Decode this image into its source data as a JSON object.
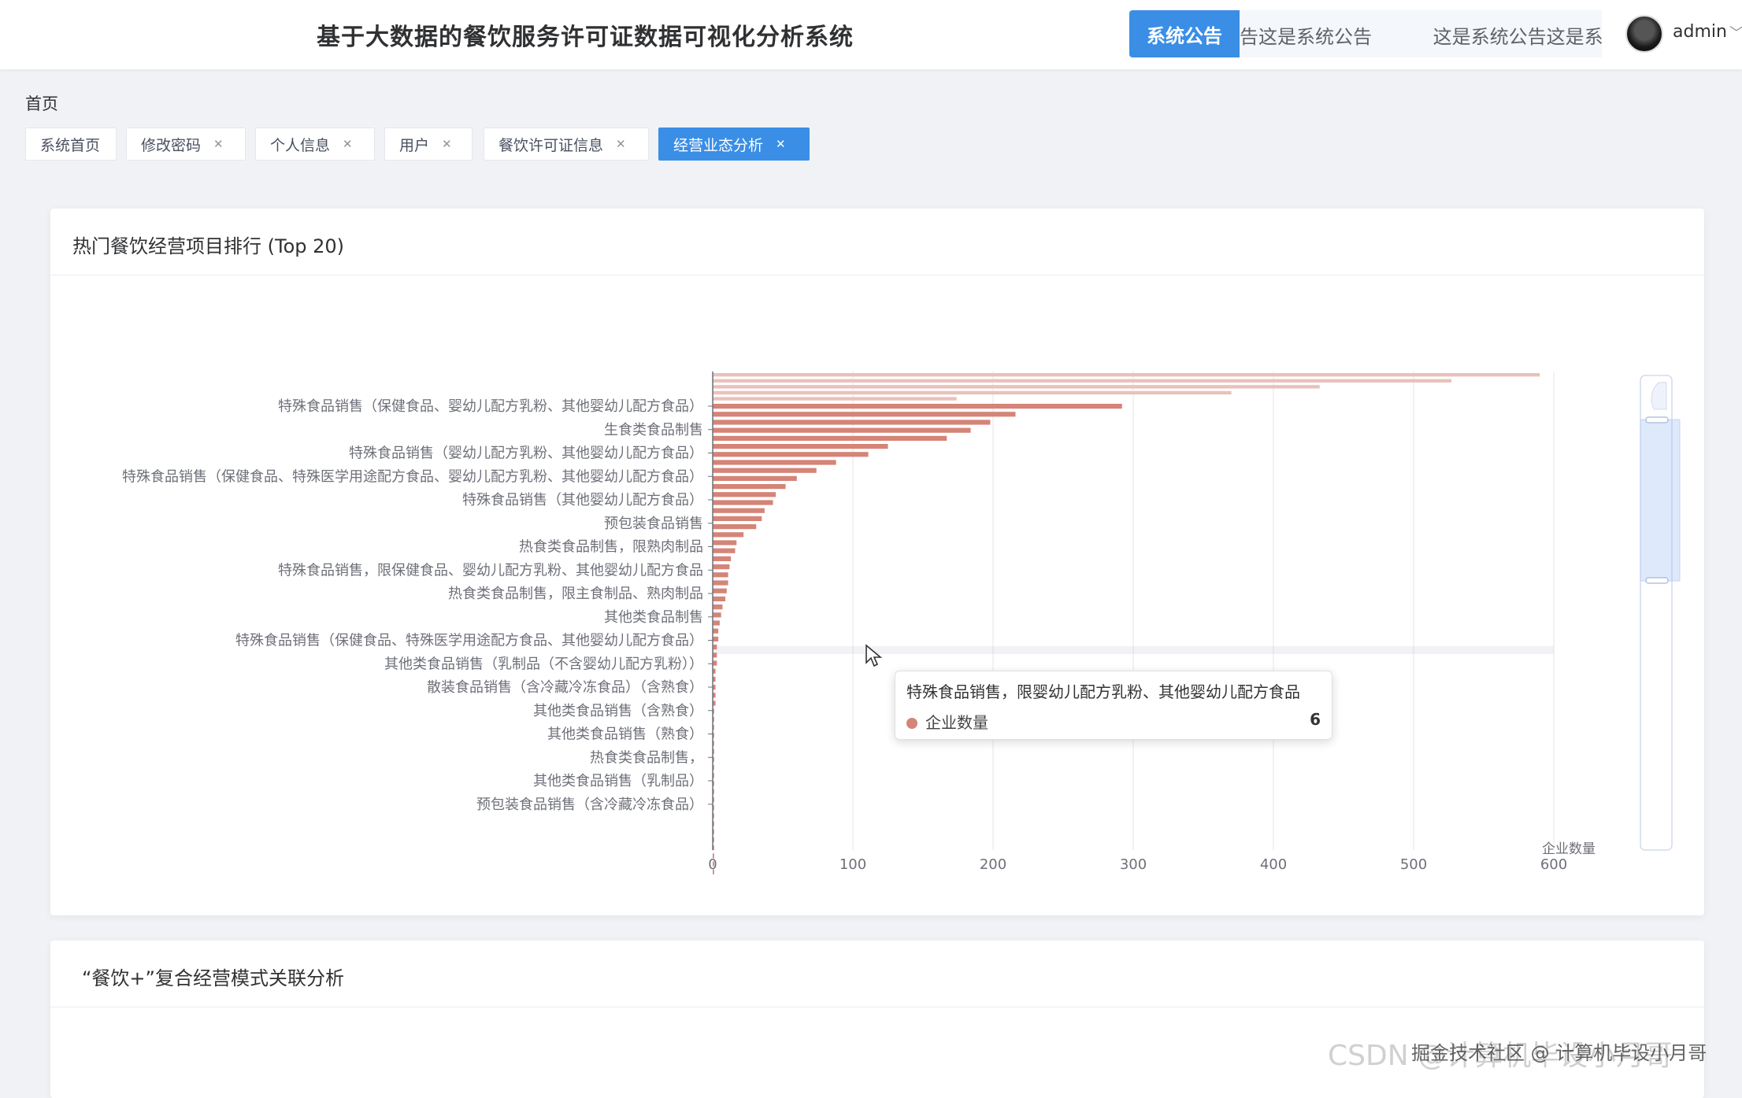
{
  "header": {
    "title": "基于大数据的餐饮服务许可证数据可视化分析系统",
    "notice_label": "系统公告",
    "notice_text": "公告这是系统公告 这是系统公告这是系",
    "username": "admin"
  },
  "breadcrumb": "首页",
  "tabs": [
    {
      "label": "系统首页",
      "closable": false,
      "active": false
    },
    {
      "label": "修改密码",
      "closable": true,
      "active": false
    },
    {
      "label": "个人信息",
      "closable": true,
      "active": false
    },
    {
      "label": "用户",
      "closable": true,
      "active": false
    },
    {
      "label": "餐饮许可证信息",
      "closable": true,
      "active": false
    },
    {
      "label": "经营业态分析",
      "closable": true,
      "active": true
    }
  ],
  "cards": {
    "top_title": "热门餐饮经营项目排行 (Top 20)",
    "bottom_title": "“餐饮+”复合经营模式关联分析"
  },
  "tooltip": {
    "title": "特殊食品销售，限婴幼儿配方乳粉、其他婴幼儿配方食品",
    "series": "企业数量",
    "value": "6"
  },
  "watermark": "CSDN @计算机毕设小月哥",
  "watermark_overlay": "掘金技术社区 @ 计算机毕设小月哥",
  "colors": {
    "primary": "#3a8ee6",
    "bar": "#d58478",
    "bar_faded": "#e9c2bb"
  },
  "chart_data": {
    "type": "bar",
    "orientation": "horizontal",
    "xlabel": "企业数量",
    "xlim": [
      0,
      600
    ],
    "x_ticks": [
      "0",
      "100",
      "200",
      "300",
      "400",
      "500",
      "600"
    ],
    "grid": true,
    "category_labels": [
      "特殊食品销售（保健食品、婴幼儿配方乳粉、其他婴幼儿配方食品）",
      "生食类食品制售",
      "特殊食品销售（婴幼儿配方乳粉、其他婴幼儿配方食品）",
      "特殊食品销售（保健食品、特殊医学用途配方食品、婴幼儿配方乳粉、其他婴幼儿配方食品）",
      "特殊食品销售（其他婴幼儿配方食品）",
      "预包装食品销售",
      "热食类食品制售，限熟肉制品",
      "特殊食品销售，限保健食品、婴幼儿配方乳粉、其他婴幼儿配方食品",
      "热食类食品制售，限主食制品、熟肉制品",
      "其他类食品制售",
      "特殊食品销售（保健食品、特殊医学用途配方食品、其他婴幼儿配方食品）",
      "其他类食品销售（乳制品（不含婴幼儿配方乳粉））",
      "散装食品销售（含冷藏冷冻食品）（含熟食）",
      "其他类食品销售（含熟食）",
      "其他类食品销售（熟食）",
      "热食类食品制售，",
      "其他类食品销售（乳制品）",
      "预包装食品销售（含冷藏冷冻食品）"
    ],
    "faded_values": [
      590,
      527,
      433,
      370,
      174
    ],
    "values": [
      292,
      216,
      198,
      184,
      167,
      125,
      111,
      88,
      74,
      60,
      52,
      45,
      43,
      37,
      35,
      31,
      22,
      17,
      16,
      13,
      12,
      11,
      11,
      10,
      9,
      7,
      6,
      5,
      4,
      4,
      3,
      3,
      3,
      2,
      2,
      2,
      2,
      2,
      1,
      1,
      1,
      1,
      1,
      1,
      1,
      1,
      1,
      1,
      1,
      1,
      1,
      1,
      1,
      1,
      1,
      1,
      1,
      1,
      1
    ]
  }
}
